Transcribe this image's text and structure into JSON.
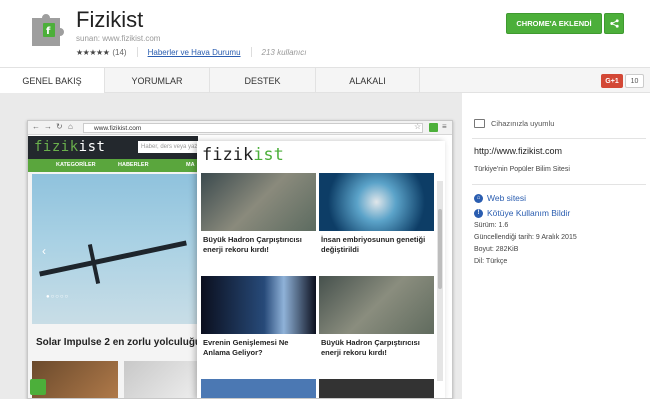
{
  "extension": {
    "title": "Fizikist",
    "offered_by": "sunan: www.fizikist.com",
    "stars": "★★★★★",
    "rating_count": "(14)",
    "category": "Haberler ve Hava Durumu",
    "users": "213 kullanıcı",
    "add_button": "CHROME'A EKLENDİ"
  },
  "tabs": [
    "GENEL BAKIŞ",
    "YORUMLAR",
    "DESTEK",
    "ALAKALI"
  ],
  "gplus": {
    "label": "G+1",
    "count": "10"
  },
  "browser": {
    "url": "www.fizikist.com",
    "site_search_placeholder": "Haber, ders veya yazı",
    "site_logo_a": "fizik",
    "site_logo_b": "ist",
    "site_nav": [
      "KATEGORİLER",
      "HABERLER",
      "MA"
    ],
    "site_headline": "Solar Impulse 2 en zorlu yolculuğu",
    "popup_logo_a": "fizik",
    "popup_logo_b": "ist",
    "cards": [
      {
        "title": "Büyük Hadron Çarpıştırıcısı enerji rekoru kırdı!"
      },
      {
        "title": "İnsan embriyosunun genetiği değiştirildi"
      },
      {
        "title": "Evrenin Genişlemesi Ne Anlama Geliyor?"
      },
      {
        "title": "Büyük Hadron Çarpıştırıcısı enerji rekoru kırdı!"
      }
    ]
  },
  "info": {
    "compat": "Cihazınızla uyumlu",
    "url": "http://www.fizikist.com",
    "description": "Türkiye'nin Popüler Bilim Sitesi",
    "website_link": "Web sitesi",
    "report_link": "Kötüye Kullanım Bildir",
    "version": "Sürüm: 1.6",
    "updated": "Güncellendiği tarih: 9 Aralık 2015",
    "size": "Boyut: 282KiB",
    "language": "Dil: Türkçe"
  }
}
